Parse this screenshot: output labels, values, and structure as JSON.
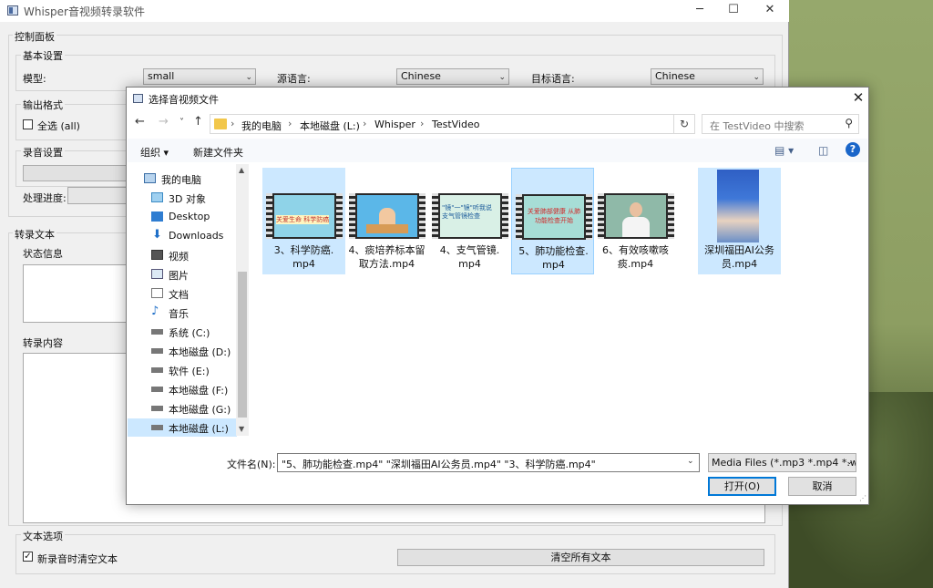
{
  "app": {
    "title": "Whisper音视频转录软件",
    "window_controls": [
      "─",
      "☐",
      "✕"
    ]
  },
  "control_panel": {
    "title": "控制面板",
    "basic_settings": {
      "title": "基本设置",
      "model_label": "模型:",
      "model_value": "small",
      "source_lang_label": "源语言:",
      "source_lang_value": "Chinese",
      "target_lang_label": "目标语言:",
      "target_lang_value": "Chinese"
    },
    "output_format": {
      "title": "输出格式",
      "select_all_label": "全选 (all)"
    },
    "recording": {
      "title": "录音设置"
    },
    "progress_label": "处理进度:"
  },
  "transcription": {
    "title": "转录文本",
    "status_label": "状态信息",
    "content_label": "转录内容"
  },
  "text_options": {
    "title": "文本选项",
    "clear_on_record_label": "新录音时清空文本",
    "clear_on_record_checked": "✓",
    "clear_all_button": "清空所有文本"
  },
  "dialog": {
    "title": "选择音视频文件",
    "close": "✕",
    "nav": {
      "back": "←",
      "forward": "→",
      "recent": "˅",
      "up": "↑"
    },
    "breadcrumb": [
      "我的电脑",
      "本地磁盘 (L:)",
      "Whisper",
      "TestVideo"
    ],
    "breadcrumb_sep": "›",
    "refresh": "↻",
    "search_placeholder": "在 TestVideo 中搜索",
    "toolbar": {
      "organize": "组织 ▾",
      "new_folder": "新建文件夹"
    },
    "nav_pane": [
      {
        "label": "我的电脑",
        "icon": "computer-icon"
      },
      {
        "label": "3D 对象",
        "icon": "3d-objects-icon"
      },
      {
        "label": "Desktop",
        "icon": "desktop-icon"
      },
      {
        "label": "Downloads",
        "icon": "downloads-icon"
      },
      {
        "label": "视频",
        "icon": "videos-icon"
      },
      {
        "label": "图片",
        "icon": "pictures-icon"
      },
      {
        "label": "文档",
        "icon": "documents-icon"
      },
      {
        "label": "音乐",
        "icon": "music-icon"
      },
      {
        "label": "系统 (C:)",
        "icon": "drive-icon"
      },
      {
        "label": "本地磁盘 (D:)",
        "icon": "drive-icon"
      },
      {
        "label": "软件 (E:)",
        "icon": "drive-icon"
      },
      {
        "label": "本地磁盘 (F:)",
        "icon": "drive-icon"
      },
      {
        "label": "本地磁盘 (G:)",
        "icon": "drive-icon"
      },
      {
        "label": "本地磁盘 (L:)",
        "icon": "drive-icon",
        "selected": true
      }
    ],
    "files": [
      {
        "name_line1": "3、科学防癌.",
        "name_line2": "mp4",
        "selected": true,
        "thumb_color": "#8fd3e8",
        "thumb_text": "关爱生命 科学防癌"
      },
      {
        "name_line1": "4、痰培养标本留",
        "name_line2": "取方法.mp4",
        "selected": false,
        "thumb_color": "#5bb7e8",
        "thumb_text": ""
      },
      {
        "name_line1": "4、支气管镜.",
        "name_line2": "mp4",
        "selected": false,
        "thumb_color": "#d9f0e6",
        "thumb_text": "\"镜\"一\"镜\"听我说 支气管镜检查"
      },
      {
        "name_line1": "5、肺功能检查.",
        "name_line2": "mp4",
        "selected": true,
        "thumb_color": "#a7ddd6",
        "thumb_text": "关爱肺部健康 从肺功能检查开始"
      },
      {
        "name_line1": "6、有效咳嗽咳",
        "name_line2": "痰.mp4",
        "selected": false,
        "thumb_color": "#8fb9a8",
        "thumb_text": ""
      },
      {
        "name_line1": "深圳福田AI公务",
        "name_line2": "员.mp4",
        "selected": true,
        "thumb_color": "#3566c9",
        "thumb_text": ""
      }
    ],
    "filename_label": "文件名(N):",
    "filename_value": "\"5、肺功能检查.mp4\" \"深圳福田AI公务员.mp4\" \"3、科学防癌.mp4\"",
    "filter_value": "Media Files (*.mp3 *.mp4 *.w",
    "open_button": "打开(O)",
    "cancel_button": "取消"
  }
}
